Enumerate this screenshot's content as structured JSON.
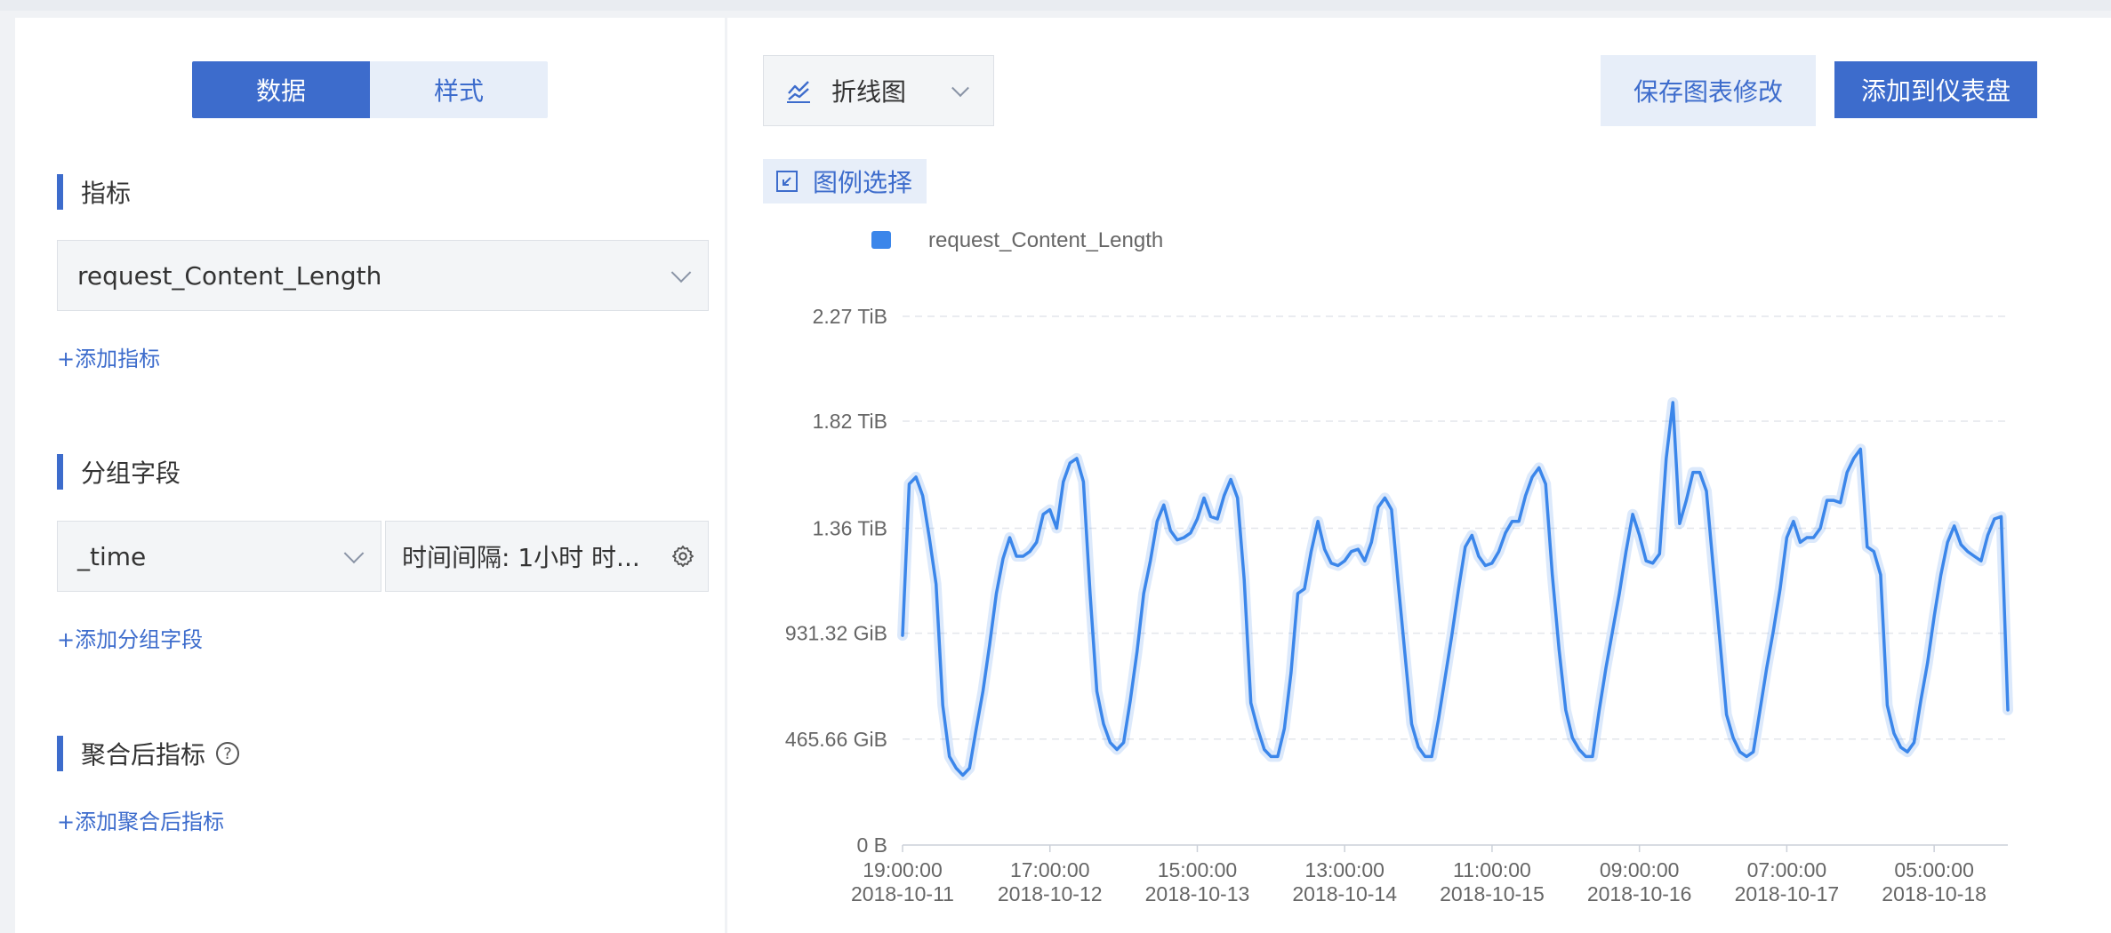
{
  "tabs": [
    {
      "label": "数据",
      "active": true
    },
    {
      "label": "样式",
      "active": false
    }
  ],
  "metrics": {
    "title": "指标",
    "selected": "request_Content_Length",
    "add_label": "+添加指标"
  },
  "group": {
    "title": "分组字段",
    "field": "_time",
    "interval": "时间间隔: 1小时 时...",
    "add_label": "+添加分组字段"
  },
  "aggregate": {
    "title": "聚合后指标",
    "help": "?",
    "add_label": "+添加聚合后指标"
  },
  "toolbar": {
    "chart_type": "折线图",
    "save_label": "保存图表修改",
    "add_label": "添加到仪表盘",
    "legend_select": "图例选择"
  },
  "colors": {
    "accent": "#3d6ccc",
    "series": "#3b86ea"
  },
  "chart_data": {
    "type": "line",
    "legend": [
      "request_Content_Length"
    ],
    "ylim": [
      0,
      2.27
    ],
    "y_unit": "TiB",
    "y_ticks": [
      {
        "value": 0,
        "label": "0 B"
      },
      {
        "value": 0.4548,
        "label": "465.66 GiB"
      },
      {
        "value": 0.9095,
        "label": "931.32 GiB"
      },
      {
        "value": 1.36,
        "label": "1.36 TiB"
      },
      {
        "value": 1.82,
        "label": "1.82 TiB"
      },
      {
        "value": 2.27,
        "label": "2.27 TiB"
      }
    ],
    "x_ticks": [
      {
        "index": 0,
        "time": "19:00:00",
        "date": "2018-10-11"
      },
      {
        "index": 22,
        "time": "17:00:00",
        "date": "2018-10-12"
      },
      {
        "index": 44,
        "time": "15:00:00",
        "date": "2018-10-13"
      },
      {
        "index": 66,
        "time": "13:00:00",
        "date": "2018-10-14"
      },
      {
        "index": 88,
        "time": "11:00:00",
        "date": "2018-10-15"
      },
      {
        "index": 110,
        "time": "09:00:00",
        "date": "2018-10-16"
      },
      {
        "index": 132,
        "time": "07:00:00",
        "date": "2018-10-17"
      },
      {
        "index": 154,
        "time": "05:00:00",
        "date": "2018-10-18"
      }
    ],
    "series": [
      {
        "name": "request_Content_Length",
        "values": [
          0.9,
          1.55,
          1.58,
          1.5,
          1.32,
          1.12,
          0.6,
          0.38,
          0.33,
          0.3,
          0.33,
          0.5,
          0.66,
          0.86,
          1.08,
          1.23,
          1.32,
          1.24,
          1.24,
          1.26,
          1.3,
          1.42,
          1.44,
          1.36,
          1.56,
          1.64,
          1.66,
          1.56,
          1.08,
          0.66,
          0.52,
          0.44,
          0.41,
          0.44,
          0.62,
          0.83,
          1.08,
          1.22,
          1.39,
          1.46,
          1.35,
          1.31,
          1.32,
          1.34,
          1.4,
          1.49,
          1.41,
          1.4,
          1.5,
          1.57,
          1.49,
          1.14,
          0.61,
          0.5,
          0.41,
          0.38,
          0.38,
          0.5,
          0.74,
          1.08,
          1.1,
          1.26,
          1.39,
          1.27,
          1.21,
          1.2,
          1.22,
          1.26,
          1.27,
          1.22,
          1.3,
          1.45,
          1.49,
          1.44,
          1.12,
          0.82,
          0.52,
          0.42,
          0.38,
          0.38,
          0.54,
          0.72,
          0.9,
          1.1,
          1.28,
          1.33,
          1.24,
          1.2,
          1.21,
          1.26,
          1.34,
          1.39,
          1.39,
          1.5,
          1.58,
          1.62,
          1.55,
          1.16,
          0.84,
          0.58,
          0.46,
          0.41,
          0.38,
          0.38,
          0.58,
          0.76,
          0.92,
          1.08,
          1.26,
          1.42,
          1.33,
          1.22,
          1.21,
          1.25,
          1.66,
          1.9,
          1.38,
          1.48,
          1.6,
          1.6,
          1.52,
          1.2,
          0.88,
          0.56,
          0.46,
          0.4,
          0.38,
          0.4,
          0.58,
          0.76,
          0.92,
          1.1,
          1.32,
          1.39,
          1.3,
          1.32,
          1.32,
          1.36,
          1.48,
          1.48,
          1.47,
          1.6,
          1.66,
          1.7,
          1.28,
          1.26,
          1.16,
          0.6,
          0.48,
          0.42,
          0.4,
          0.44,
          0.62,
          0.78,
          0.98,
          1.16,
          1.3,
          1.37,
          1.29,
          1.26,
          1.24,
          1.22,
          1.33,
          1.4,
          1.41,
          0.58
        ]
      }
    ]
  }
}
